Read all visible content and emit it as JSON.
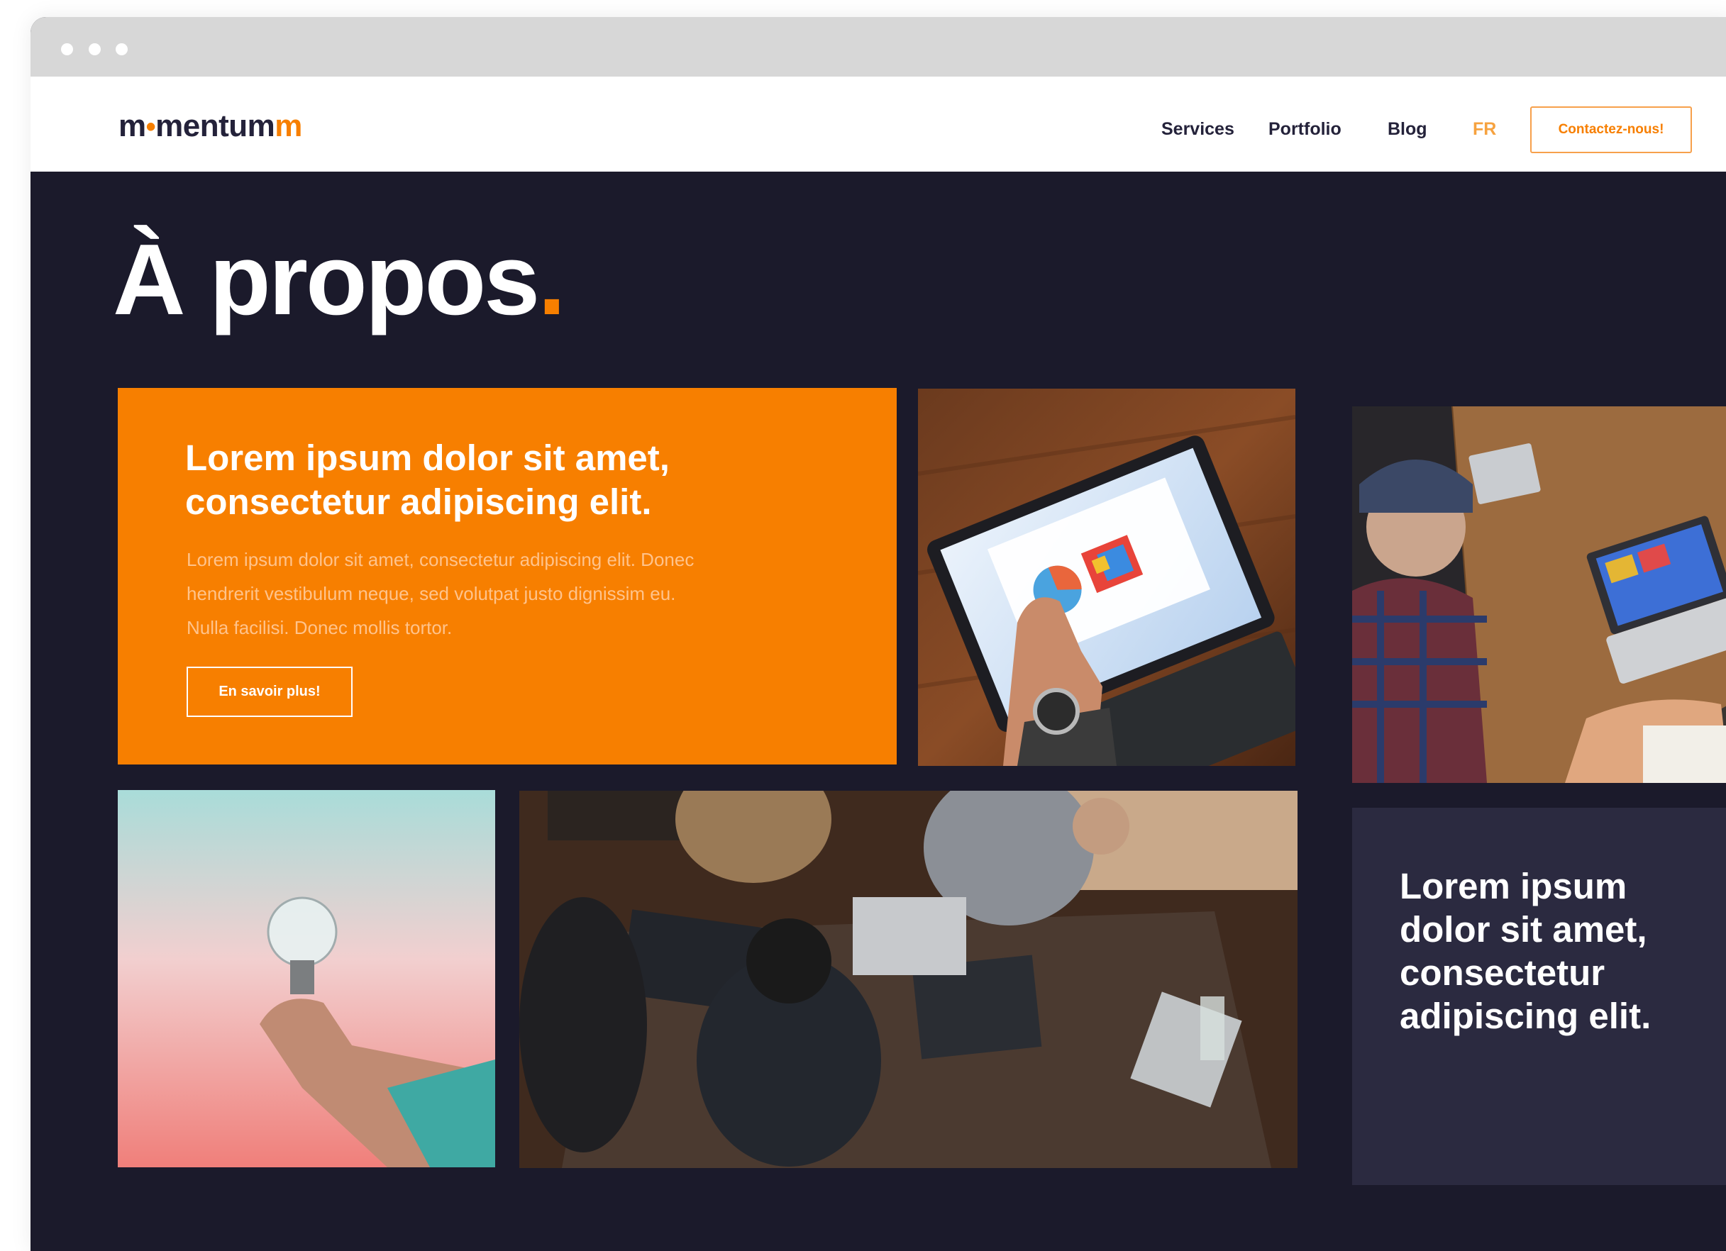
{
  "brand": {
    "logo_prefix": "m",
    "logo_dot": "•",
    "logo_suffix": "mentum",
    "logo_accent": "m"
  },
  "nav": {
    "items": [
      {
        "label": "Services"
      },
      {
        "label": "Portfolio"
      },
      {
        "label": "Blog"
      }
    ],
    "language": "FR",
    "contact_label": "Contactez-nous!"
  },
  "hero": {
    "title": "À propos",
    "title_period": "."
  },
  "feature_card": {
    "heading": "Lorem ipsum dolor sit amet, consectetur adipiscing elit.",
    "body": "Lorem ipsum dolor sit amet, consectetur adipiscing elit. Donec hendrerit vestibulum neque, sed volutpat justo dignissim eu. Nulla facilisi. Donec mollis tortor.",
    "button_label": "En savoir plus!"
  },
  "quote_card": {
    "heading": "Lorem ipsum dolor sit amet, consectetur adipiscing elit."
  },
  "images": [
    {
      "name": "tablet-photo"
    },
    {
      "name": "meeting-photo"
    },
    {
      "name": "lightbulb-photo"
    },
    {
      "name": "team-laptops-photo"
    }
  ],
  "colors": {
    "accent": "#f77f00",
    "dark_background": "#1b1a2b",
    "card_dark": "#2b2a40",
    "text_dark": "#24223a"
  }
}
